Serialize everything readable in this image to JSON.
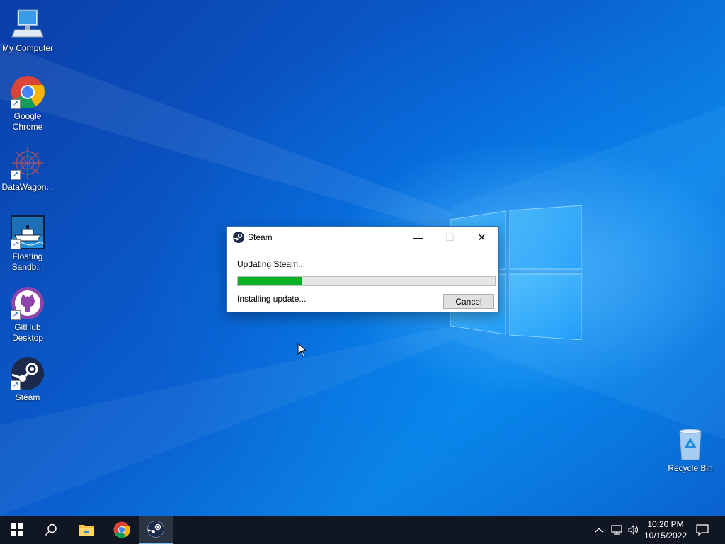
{
  "desktop": {
    "icons": [
      {
        "label": "My Computer",
        "icon": "computer-icon"
      },
      {
        "label": "Google Chrome",
        "icon": "chrome-icon"
      },
      {
        "label": "DataWagon...",
        "icon": "datawagon-icon"
      },
      {
        "label": "Floating Sandb...",
        "icon": "ship-icon"
      },
      {
        "label": "GitHub Desktop",
        "icon": "github-icon"
      },
      {
        "label": "Steam",
        "icon": "steam-icon"
      },
      {
        "label": "Recycle Bin",
        "icon": "recycle-bin-icon"
      }
    ]
  },
  "dialog": {
    "title": "Steam",
    "status": "Updating Steam...",
    "progress": 0.25,
    "detail": "Installing update...",
    "cancel_label": "Cancel",
    "minimize_glyph": "—",
    "maximize_glyph": "☐",
    "close_glyph": "✕"
  },
  "taskbar": {
    "items": [
      "start-icon",
      "search-icon",
      "file-explorer-icon",
      "chrome-icon",
      "steam-icon"
    ],
    "active": "steam-icon",
    "tray_icons": [
      "chevron-up-icon",
      "network-icon",
      "volume-icon"
    ],
    "time": "10:20 PM",
    "date": "10/15/2022",
    "notification_icon": "action-center-icon"
  },
  "colors": {
    "progress_fill": "#06b025",
    "taskbar_bg": "#101722",
    "accent": "#76b9ed"
  }
}
